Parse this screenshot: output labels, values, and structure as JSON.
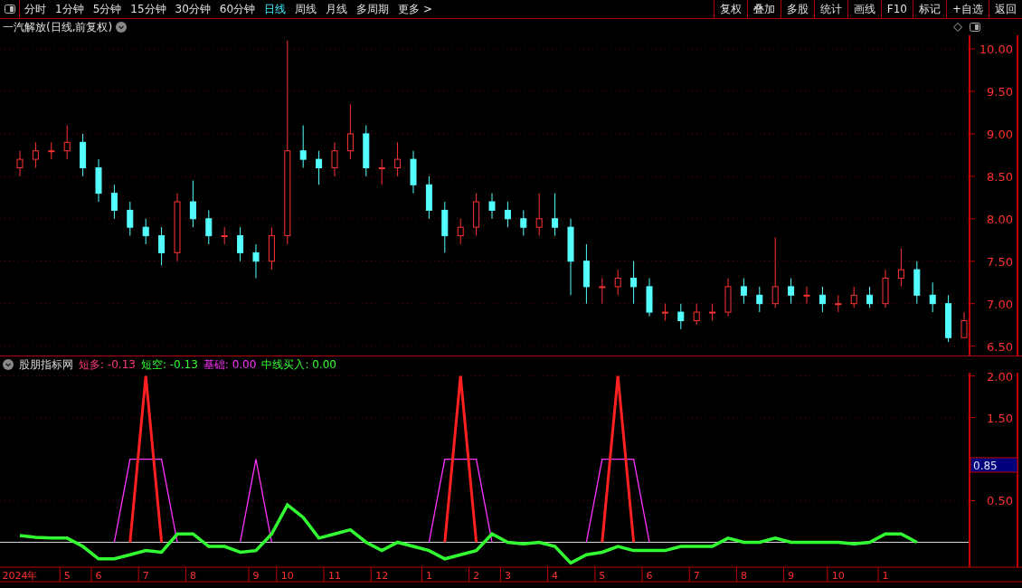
{
  "toolbar": {
    "periods": [
      {
        "label": "分时",
        "selected": false
      },
      {
        "label": "1分钟",
        "selected": false
      },
      {
        "label": "5分钟",
        "selected": false
      },
      {
        "label": "15分钟",
        "selected": false
      },
      {
        "label": "30分钟",
        "selected": false
      },
      {
        "label": "60分钟",
        "selected": false
      },
      {
        "label": "日线",
        "selected": true
      },
      {
        "label": "周线",
        "selected": false
      },
      {
        "label": "月线",
        "selected": false
      },
      {
        "label": "多周期",
        "selected": false
      },
      {
        "label": "更多 >",
        "selected": false
      }
    ],
    "actions": [
      "复权",
      "叠加",
      "多股",
      "统计",
      "画线",
      "F10",
      "标记",
      "+自选",
      "返回"
    ]
  },
  "main_chart": {
    "title": "一汽解放(日线,前复权)",
    "chart_data": {
      "type": "candlestick",
      "grid": true,
      "ylim": [
        6.4,
        10.15
      ],
      "yticks": [
        {
          "value": 6.5,
          "label": "6.50"
        },
        {
          "value": 7,
          "label": "7.00"
        },
        {
          "value": 7.5,
          "label": "7.50"
        },
        {
          "value": 8,
          "label": "8.00"
        },
        {
          "value": 8.5,
          "label": "8.50"
        },
        {
          "value": 9,
          "label": "9.00"
        },
        {
          "value": 9.5,
          "label": "9.50"
        },
        {
          "value": 10,
          "label": "10.00"
        }
      ],
      "ohlc": [
        [
          8.6,
          8.8,
          8.5,
          8.7
        ],
        [
          8.7,
          8.9,
          8.6,
          8.8
        ],
        [
          8.8,
          8.9,
          8.7,
          8.8
        ],
        [
          8.8,
          9.1,
          8.7,
          8.9
        ],
        [
          8.9,
          9.0,
          8.5,
          8.6
        ],
        [
          8.6,
          8.7,
          8.2,
          8.3
        ],
        [
          8.3,
          8.4,
          8.0,
          8.1
        ],
        [
          8.1,
          8.2,
          7.8,
          7.9
        ],
        [
          7.9,
          8.0,
          7.7,
          7.8
        ],
        [
          7.8,
          7.9,
          7.45,
          7.6
        ],
        [
          7.6,
          8.3,
          7.5,
          8.2
        ],
        [
          8.2,
          8.45,
          7.9,
          8.0
        ],
        [
          8.0,
          8.1,
          7.7,
          7.8
        ],
        [
          7.8,
          7.9,
          7.7,
          7.8
        ],
        [
          7.8,
          7.9,
          7.5,
          7.6
        ],
        [
          7.6,
          7.7,
          7.3,
          7.5
        ],
        [
          7.5,
          7.9,
          7.4,
          7.8
        ],
        [
          7.8,
          10.1,
          7.7,
          8.8
        ],
        [
          8.8,
          9.1,
          8.6,
          8.7
        ],
        [
          8.7,
          8.8,
          8.4,
          8.6
        ],
        [
          8.6,
          8.9,
          8.5,
          8.8
        ],
        [
          8.8,
          9.35,
          8.7,
          9.0
        ],
        [
          9.0,
          9.1,
          8.5,
          8.6
        ],
        [
          8.6,
          8.7,
          8.4,
          8.6
        ],
        [
          8.6,
          8.9,
          8.5,
          8.7
        ],
        [
          8.7,
          8.8,
          8.3,
          8.4
        ],
        [
          8.4,
          8.5,
          8.0,
          8.1
        ],
        [
          8.1,
          8.2,
          7.6,
          7.8
        ],
        [
          7.8,
          8.0,
          7.7,
          7.9
        ],
        [
          7.9,
          8.3,
          7.8,
          8.2
        ],
        [
          8.2,
          8.3,
          8.0,
          8.1
        ],
        [
          8.1,
          8.2,
          7.9,
          8.0
        ],
        [
          8.0,
          8.1,
          7.8,
          7.9
        ],
        [
          7.9,
          8.3,
          7.8,
          8.0
        ],
        [
          8.0,
          8.3,
          7.8,
          7.9
        ],
        [
          7.9,
          8.0,
          7.1,
          7.5
        ],
        [
          7.5,
          7.7,
          7.0,
          7.2
        ],
        [
          7.2,
          7.3,
          7.0,
          7.2
        ],
        [
          7.2,
          7.4,
          7.1,
          7.3
        ],
        [
          7.3,
          7.5,
          7.0,
          7.2
        ],
        [
          7.2,
          7.3,
          6.85,
          6.9
        ],
        [
          6.9,
          7.0,
          6.8,
          6.9
        ],
        [
          6.9,
          7.0,
          6.7,
          6.8
        ],
        [
          6.8,
          7.0,
          6.75,
          6.9
        ],
        [
          6.9,
          7.0,
          6.8,
          6.9
        ],
        [
          6.9,
          7.3,
          6.85,
          7.2
        ],
        [
          7.2,
          7.3,
          7.0,
          7.1
        ],
        [
          7.1,
          7.2,
          6.9,
          7.0
        ],
        [
          7.0,
          7.78,
          6.95,
          7.2
        ],
        [
          7.2,
          7.3,
          7.0,
          7.1
        ],
        [
          7.1,
          7.2,
          7.0,
          7.1
        ],
        [
          7.1,
          7.2,
          6.9,
          7.0
        ],
        [
          7.0,
          7.1,
          6.9,
          7.0
        ],
        [
          7.0,
          7.2,
          6.95,
          7.1
        ],
        [
          7.1,
          7.2,
          6.95,
          7.0
        ],
        [
          7.0,
          7.4,
          6.95,
          7.3
        ],
        [
          7.3,
          7.65,
          7.2,
          7.4
        ],
        [
          7.4,
          7.5,
          7.0,
          7.1
        ],
        [
          7.1,
          7.25,
          6.9,
          7.0
        ],
        [
          7.0,
          7.1,
          6.55,
          6.6
        ],
        [
          6.6,
          6.9,
          6.6,
          6.8
        ]
      ]
    }
  },
  "indicator": {
    "name": "股朋指标网",
    "legend": [
      {
        "label": "短多: -0.13",
        "color": "#ff3c78"
      },
      {
        "label": "短空: -0.13",
        "color": "#32ff32"
      },
      {
        "label": "基础: 0.00",
        "color": "#ff32ff"
      },
      {
        "label": "中线买入: 0.00",
        "color": "#32ff32"
      }
    ],
    "marker": "0.85",
    "chart_data": {
      "type": "line",
      "grid": true,
      "ylim": [
        -0.3,
        2.04
      ],
      "yticks": [
        {
          "value": 0.5,
          "label": "0.50"
        },
        {
          "value": 1.5,
          "label": "1.50"
        },
        {
          "value": 2,
          "label": "2.00"
        }
      ],
      "categories": [
        "2024年",
        null,
        null,
        "5",
        null,
        "6",
        null,
        null,
        "7",
        null,
        null,
        "8",
        null,
        null,
        null,
        "9",
        null,
        "10",
        null,
        null,
        "11",
        null,
        null,
        "12",
        null,
        null,
        "1",
        null,
        null,
        "2",
        null,
        "3",
        null,
        null,
        "4",
        null,
        null,
        "5",
        null,
        null,
        "6",
        null,
        null,
        "7",
        null,
        null,
        "8",
        null,
        null,
        "9",
        null,
        null,
        "10",
        null,
        null,
        "1",
        null,
        null,
        null,
        null,
        null
      ],
      "series": [
        {
          "color": "#ff32ff",
          "values": [
            null,
            null,
            null,
            null,
            null,
            null,
            0,
            1,
            1,
            1,
            0,
            null,
            null,
            null,
            0,
            1,
            0,
            null,
            null,
            null,
            null,
            null,
            null,
            null,
            null,
            null,
            0,
            1,
            1,
            1,
            0,
            null,
            null,
            null,
            null,
            null,
            0,
            1,
            1,
            1,
            0,
            null,
            null,
            null,
            null,
            null,
            null,
            null,
            null,
            null,
            null,
            null,
            null,
            null,
            null,
            null,
            null,
            null,
            null,
            null,
            null
          ]
        },
        {
          "color": "#ff2020",
          "values": [
            null,
            null,
            null,
            null,
            null,
            null,
            null,
            0,
            2,
            0,
            null,
            null,
            null,
            null,
            null,
            null,
            null,
            null,
            null,
            null,
            null,
            null,
            null,
            null,
            null,
            null,
            null,
            0,
            2,
            0,
            null,
            null,
            null,
            null,
            null,
            null,
            null,
            0,
            2,
            0,
            null,
            null,
            null,
            null,
            null,
            null,
            null,
            null,
            null,
            null,
            null,
            null,
            null,
            null,
            null,
            null,
            null,
            null,
            null,
            null,
            null
          ]
        },
        {
          "color": "#32ff32",
          "values": [
            0.08,
            0.06,
            0.05,
            0.05,
            -0.05,
            -0.2,
            -0.2,
            -0.15,
            -0.1,
            -0.12,
            0.1,
            0.1,
            -0.05,
            -0.05,
            -0.12,
            -0.1,
            0.1,
            0.45,
            0.3,
            0.05,
            0.1,
            0.15,
            0,
            -0.1,
            0,
            -0.05,
            -0.1,
            -0.2,
            -0.15,
            -0.1,
            0.1,
            0,
            -0.02,
            0,
            -0.05,
            -0.25,
            -0.15,
            -0.12,
            -0.05,
            -0.1,
            -0.1,
            -0.1,
            -0.05,
            -0.05,
            -0.05,
            0.05,
            0,
            0,
            0.05,
            0,
            0,
            0,
            0,
            -0.02,
            0,
            0.1,
            0.1,
            0,
            null,
            null,
            null
          ]
        }
      ]
    }
  }
}
